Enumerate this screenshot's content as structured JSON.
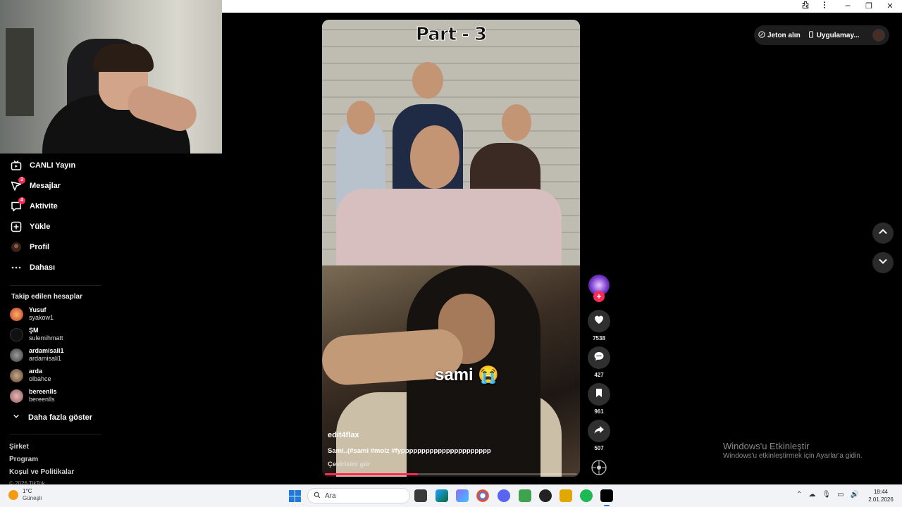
{
  "browser": {
    "extensions_icon": "puzzle-icon",
    "menu_icon": "kebab-icon",
    "minimize": "─",
    "restore": "❐",
    "close": "✕"
  },
  "sidebar": {
    "nav": [
      {
        "label": "CANLI Yayın",
        "icon": "live-icon",
        "badge": ""
      },
      {
        "label": "Mesajlar",
        "icon": "paper-plane-icon",
        "badge": "3"
      },
      {
        "label": "Aktivite",
        "icon": "chat-bubble-icon",
        "badge": "4"
      },
      {
        "label": "Yükle",
        "icon": "plus-square-icon",
        "badge": ""
      },
      {
        "label": "Profil",
        "icon": "avatar-icon",
        "badge": ""
      },
      {
        "label": "Dahası",
        "icon": "ellipsis-icon",
        "badge": ""
      }
    ],
    "following_title": "Takip edilen hesaplar",
    "following": [
      {
        "name": "Yusuf",
        "username": "syakow1"
      },
      {
        "name": "ŞM",
        "username": "sulemihmatt"
      },
      {
        "name": "ardamisali1",
        "username": "ardamisali1"
      },
      {
        "name": "arda",
        "username": "olbahce"
      },
      {
        "name": "bereenlls",
        "username": "bereenlls"
      }
    ],
    "show_more": "Daha fazla göster",
    "footer": [
      "Şirket",
      "Program",
      "Koşul ve Politikalar",
      "© 2026 TikTok"
    ]
  },
  "video": {
    "overlay_title": "Part - 3",
    "sticker_text": "sami 😭",
    "author": "edit4flax",
    "caption": "Sami..(#sami #moiz #fypppppppppppppppppppppp",
    "translate": "Çevirisini gör",
    "progress": 0.37
  },
  "actions": {
    "likes": "7538",
    "comments": "427",
    "saves": "961",
    "shares": "507"
  },
  "topbar": {
    "coins": "Jeton alın",
    "app": "Uygulamay..."
  },
  "watermark": {
    "line1": "Windows'u Etkinleştir",
    "line2": "Windows'u etkinleştirmek için Ayarlar'a gidin."
  },
  "taskbar": {
    "temperature": "1°C",
    "weather": "Güneşli",
    "search_placeholder": "Ara",
    "time": "18:44",
    "date": "2.01.2026"
  },
  "colors": {
    "accent": "#fe2c55",
    "background": "#000000",
    "taskbar": "#f1f3f7"
  }
}
